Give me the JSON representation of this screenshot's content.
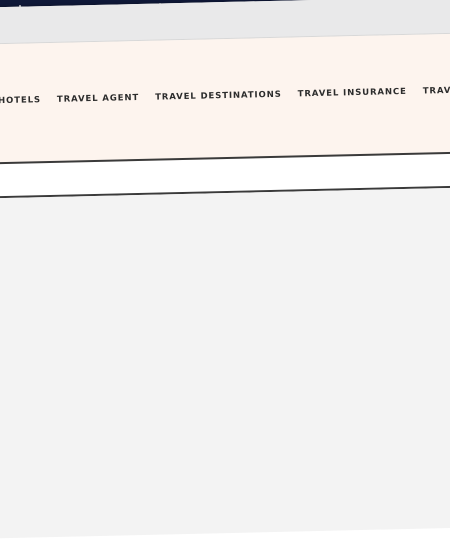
{
  "nav": {
    "items": [
      {
        "label": "HOTELS"
      },
      {
        "label": "TRAVEL AGENT"
      },
      {
        "label": "TRAVEL DESTINATIONS"
      },
      {
        "label": "TRAVEL INSURANCE"
      },
      {
        "label": "TRAVEL NEWS"
      }
    ]
  },
  "colors": {
    "header_background": "#fdf4ee",
    "page_background": "#f3f3f3",
    "nav_text": "#2c2c2c",
    "night_sky": "#0f1838"
  }
}
